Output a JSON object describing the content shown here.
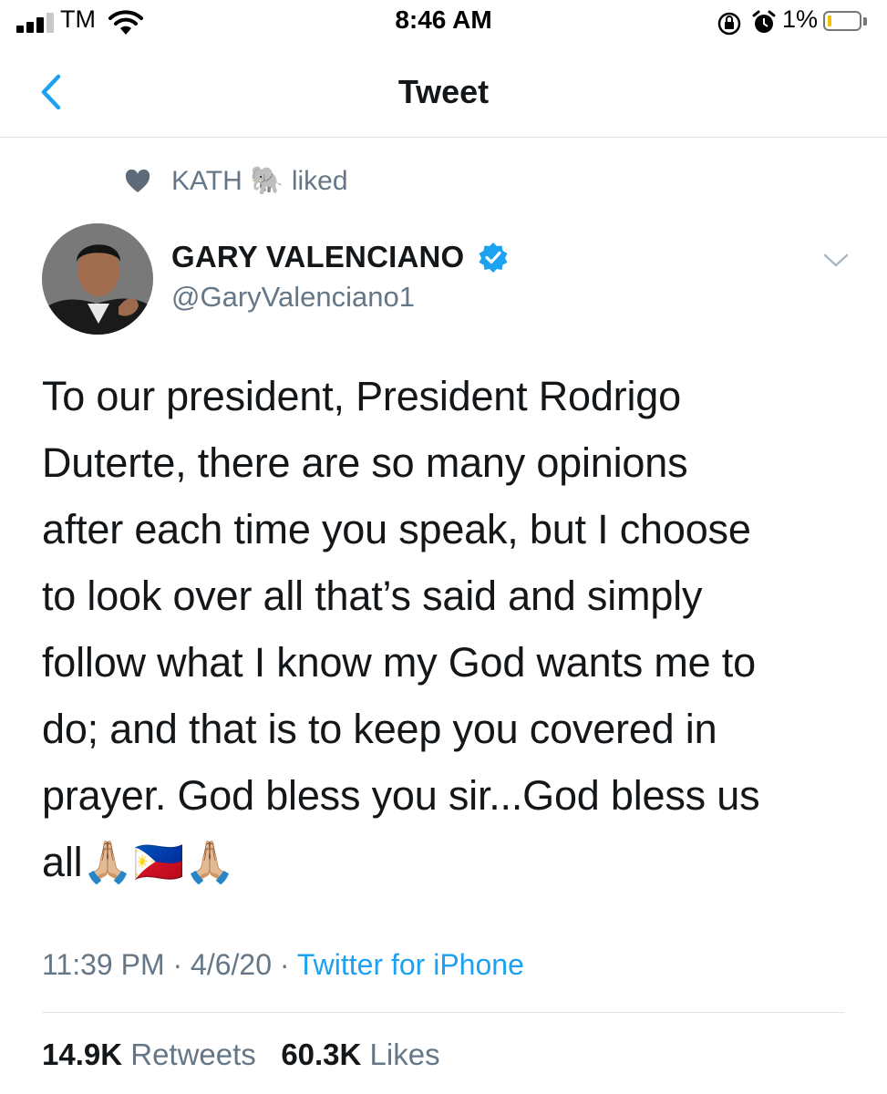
{
  "status_bar": {
    "carrier": "TM",
    "time": "8:46 AM",
    "battery_percent": "1%",
    "battery_level": 0.01
  },
  "nav": {
    "title": "Tweet"
  },
  "social_context": {
    "liker_name": "KATH",
    "liker_emoji": "🐘",
    "action": "liked"
  },
  "tweet": {
    "display_name": "GARY VALENCIANO",
    "handle": "@GaryValenciano1",
    "verified": true,
    "text_lines": [
      "To our president, President Rodrigo",
      "Duterte, there are so many opinions",
      "after each time you speak, but I choose",
      "to look over all that’s said and simply",
      "follow what I know my God wants me to",
      "do; and that is to keep you covered in",
      "prayer. God bless you sir...God bless us",
      "all🙏🏼🇵🇭🙏🏼"
    ],
    "time": "11:39 PM",
    "separator": "·",
    "date": "4/6/20",
    "source": "Twitter for iPhone",
    "retweets_count": "14.9K",
    "retweets_label": "Retweets",
    "likes_count": "60.3K",
    "likes_label": "Likes"
  },
  "colors": {
    "link_blue": "#1da1f2",
    "secondary_gray": "#657786",
    "divider": "#dfe3e8"
  }
}
